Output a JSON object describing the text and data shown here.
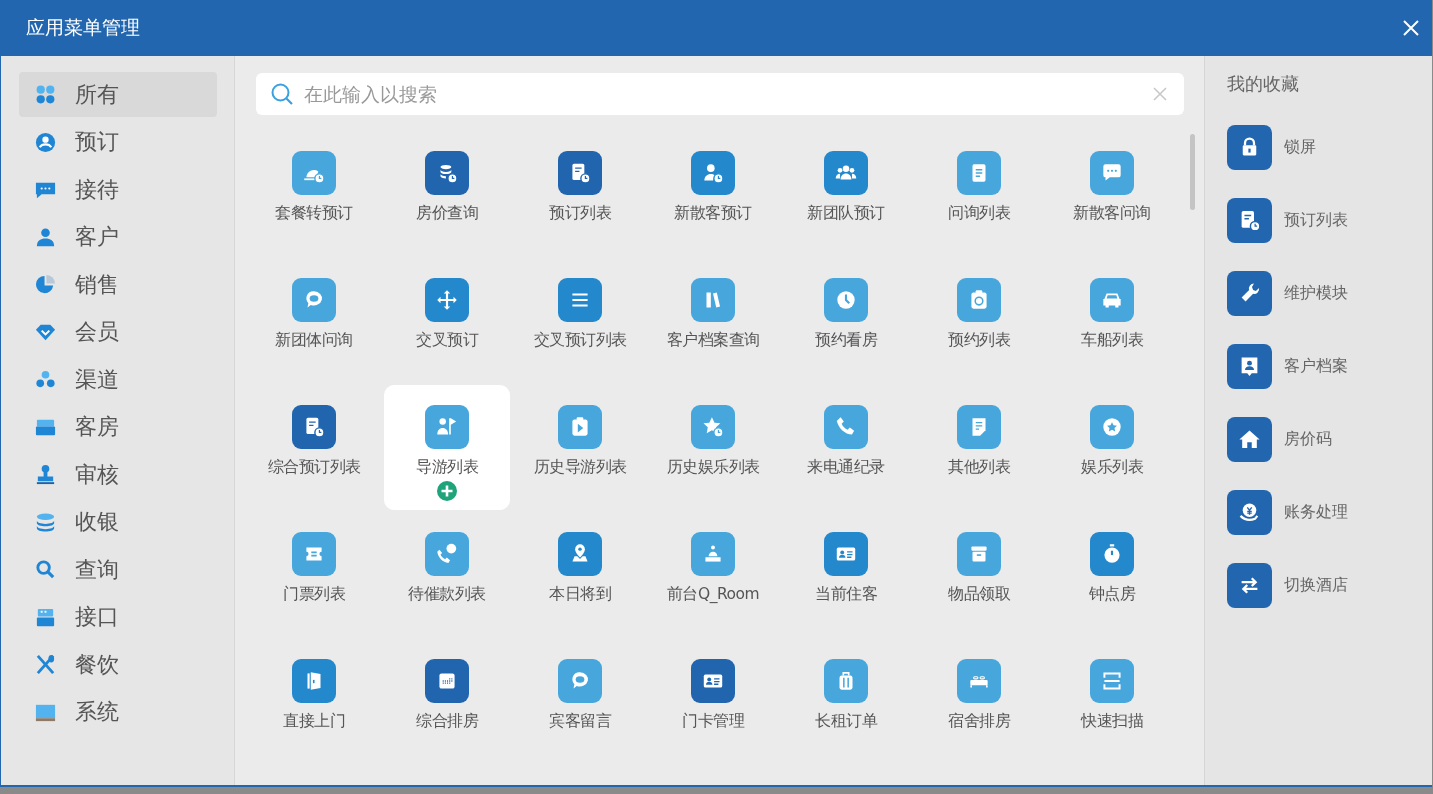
{
  "window": {
    "title": "应用菜单管理"
  },
  "sidebar": {
    "items": [
      {
        "label": "所有",
        "selected": true
      },
      {
        "label": "预订",
        "selected": false
      },
      {
        "label": "接待",
        "selected": false
      },
      {
        "label": "客户",
        "selected": false
      },
      {
        "label": "销售",
        "selected": false
      },
      {
        "label": "会员",
        "selected": false
      },
      {
        "label": "渠道",
        "selected": false
      },
      {
        "label": "客房",
        "selected": false
      },
      {
        "label": "审核",
        "selected": false
      },
      {
        "label": "收银",
        "selected": false
      },
      {
        "label": "查询",
        "selected": false
      },
      {
        "label": "接口",
        "selected": false
      },
      {
        "label": "餐饮",
        "selected": false
      },
      {
        "label": "系统",
        "selected": false
      }
    ]
  },
  "search": {
    "placeholder": "在此输入以搜索"
  },
  "apps": [
    {
      "label": "套餐转预订",
      "color": "#47a7dc",
      "hovered": false
    },
    {
      "label": "房价查询",
      "color": "#2165af",
      "hovered": false
    },
    {
      "label": "预订列表",
      "color": "#2165af",
      "hovered": false
    },
    {
      "label": "新散客预订",
      "color": "#2489cc",
      "hovered": false
    },
    {
      "label": "新团队预订",
      "color": "#2489cc",
      "hovered": false
    },
    {
      "label": "问询列表",
      "color": "#47a7dc",
      "hovered": false
    },
    {
      "label": "新散客问询",
      "color": "#47a7dc",
      "hovered": false
    },
    {
      "label": "新团体问询",
      "color": "#47a7dc",
      "hovered": false
    },
    {
      "label": "交叉预订",
      "color": "#2489cc",
      "hovered": false
    },
    {
      "label": "交叉预订列表",
      "color": "#2489cc",
      "hovered": false
    },
    {
      "label": "客户档案查询",
      "color": "#47a7dc",
      "hovered": false
    },
    {
      "label": "预约看房",
      "color": "#47a7dc",
      "hovered": false
    },
    {
      "label": "预约列表",
      "color": "#47a7dc",
      "hovered": false
    },
    {
      "label": "车船列表",
      "color": "#47a7dc",
      "hovered": false
    },
    {
      "label": "综合预订列表",
      "color": "#2165af",
      "hovered": false
    },
    {
      "label": "导游列表",
      "color": "#47a7dc",
      "hovered": true
    },
    {
      "label": "历史导游列表",
      "color": "#47a7dc",
      "hovered": false
    },
    {
      "label": "历史娱乐列表",
      "color": "#47a7dc",
      "hovered": false
    },
    {
      "label": "来电通纪录",
      "color": "#47a7dc",
      "hovered": false
    },
    {
      "label": "其他列表",
      "color": "#47a7dc",
      "hovered": false
    },
    {
      "label": "娱乐列表",
      "color": "#47a7dc",
      "hovered": false
    },
    {
      "label": "门票列表",
      "color": "#47a7dc",
      "hovered": false
    },
    {
      "label": "待催款列表",
      "color": "#47a7dc",
      "hovered": false
    },
    {
      "label": "本日将到",
      "color": "#2489cc",
      "hovered": false
    },
    {
      "label": "前台Q_Room",
      "color": "#47a7dc",
      "hovered": false
    },
    {
      "label": "当前住客",
      "color": "#2489cc",
      "hovered": false
    },
    {
      "label": "物品领取",
      "color": "#47a7dc",
      "hovered": false
    },
    {
      "label": "钟点房",
      "color": "#2489cc",
      "hovered": false
    },
    {
      "label": "直接上门",
      "color": "#2489cc",
      "hovered": false
    },
    {
      "label": "综合排房",
      "color": "#2165af",
      "hovered": false
    },
    {
      "label": "宾客留言",
      "color": "#47a7dc",
      "hovered": false
    },
    {
      "label": "门卡管理",
      "color": "#2165af",
      "hovered": false
    },
    {
      "label": "长租订单",
      "color": "#47a7dc",
      "hovered": false
    },
    {
      "label": "宿舍排房",
      "color": "#47a7dc",
      "hovered": false
    },
    {
      "label": "快速扫描",
      "color": "#47a7dc",
      "hovered": false
    }
  ],
  "favorites": {
    "title": "我的收藏",
    "items": [
      {
        "label": "锁屏"
      },
      {
        "label": "预订列表"
      },
      {
        "label": "维护模块"
      },
      {
        "label": "客户档案"
      },
      {
        "label": "房价码"
      },
      {
        "label": "账务处理"
      },
      {
        "label": "切换酒店"
      }
    ]
  }
}
